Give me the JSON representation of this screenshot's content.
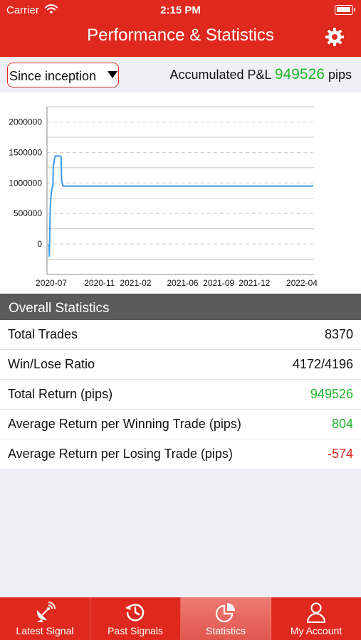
{
  "status_bar": {
    "carrier": "Carrier",
    "time": "2:15 PM"
  },
  "header": {
    "title": "Performance & Statistics",
    "settings_icon": "gear-icon"
  },
  "range_selector": {
    "value": "Since inception"
  },
  "pnl": {
    "label": "Accumulated P&L",
    "value": "949526",
    "unit": "pips"
  },
  "chart_data": {
    "type": "line",
    "series": [
      {
        "color": "#3d9be9",
        "points": [
          [
            "2020-06-25",
            0
          ],
          [
            "2020-06-26",
            -200000
          ],
          [
            "2020-06-27",
            200000
          ],
          [
            "2020-06-28",
            500000
          ],
          [
            "2020-06-29",
            700000
          ],
          [
            "2020-07-02",
            900000
          ],
          [
            "2020-07-05",
            950000
          ],
          [
            "2020-07-06",
            1300000
          ],
          [
            "2020-07-08",
            1320000
          ],
          [
            "2020-07-09",
            1400000
          ],
          [
            "2020-07-11",
            1440000
          ],
          [
            "2020-07-17",
            1440000
          ],
          [
            "2020-07-24",
            1440000
          ],
          [
            "2020-07-26",
            1420000
          ],
          [
            "2020-07-27",
            1050000
          ],
          [
            "2020-07-29",
            1000000
          ],
          [
            "2020-07-31",
            949526
          ],
          [
            "2022-04-30",
            949526
          ]
        ]
      }
    ],
    "x_ticks": [
      "2020-07",
      "2020-11",
      "2021-02",
      "2021-06",
      "2021-09",
      "2021-12",
      "2022-04"
    ],
    "y_ticks": [
      "0",
      "500000",
      "1000000",
      "1500000",
      "2000000"
    ],
    "xlim": [
      "2020-06-20",
      "2022-05-02"
    ],
    "ylim": [
      -500000,
      2250000
    ],
    "grid": true
  },
  "overall_statistics": {
    "title": "Overall Statistics",
    "rows": [
      {
        "label": "Total Trades",
        "value": "8370",
        "tone": "default"
      },
      {
        "label": "Win/Lose Ratio",
        "value": "4172/4196",
        "tone": "default"
      },
      {
        "label": "Total Return (pips)",
        "value": "949526",
        "tone": "positive"
      },
      {
        "label": "Average Return per Winning Trade (pips)",
        "value": "804",
        "tone": "positive"
      },
      {
        "label": "Average Return per Losing Trade (pips)",
        "value": "-574",
        "tone": "negative"
      }
    ]
  },
  "colors": {
    "brand": "#e0291e",
    "positive": "#1fb72a",
    "negative": "#e0241a",
    "line": "#3d9be9"
  },
  "tabs": [
    {
      "label": "Latest Signal",
      "icon": "satellite-dish-icon",
      "active": false
    },
    {
      "label": "Past Signals",
      "icon": "history-icon",
      "active": false
    },
    {
      "label": "Statistics",
      "icon": "pie-chart-icon",
      "active": true
    },
    {
      "label": "My Account",
      "icon": "user-icon",
      "active": false
    }
  ]
}
